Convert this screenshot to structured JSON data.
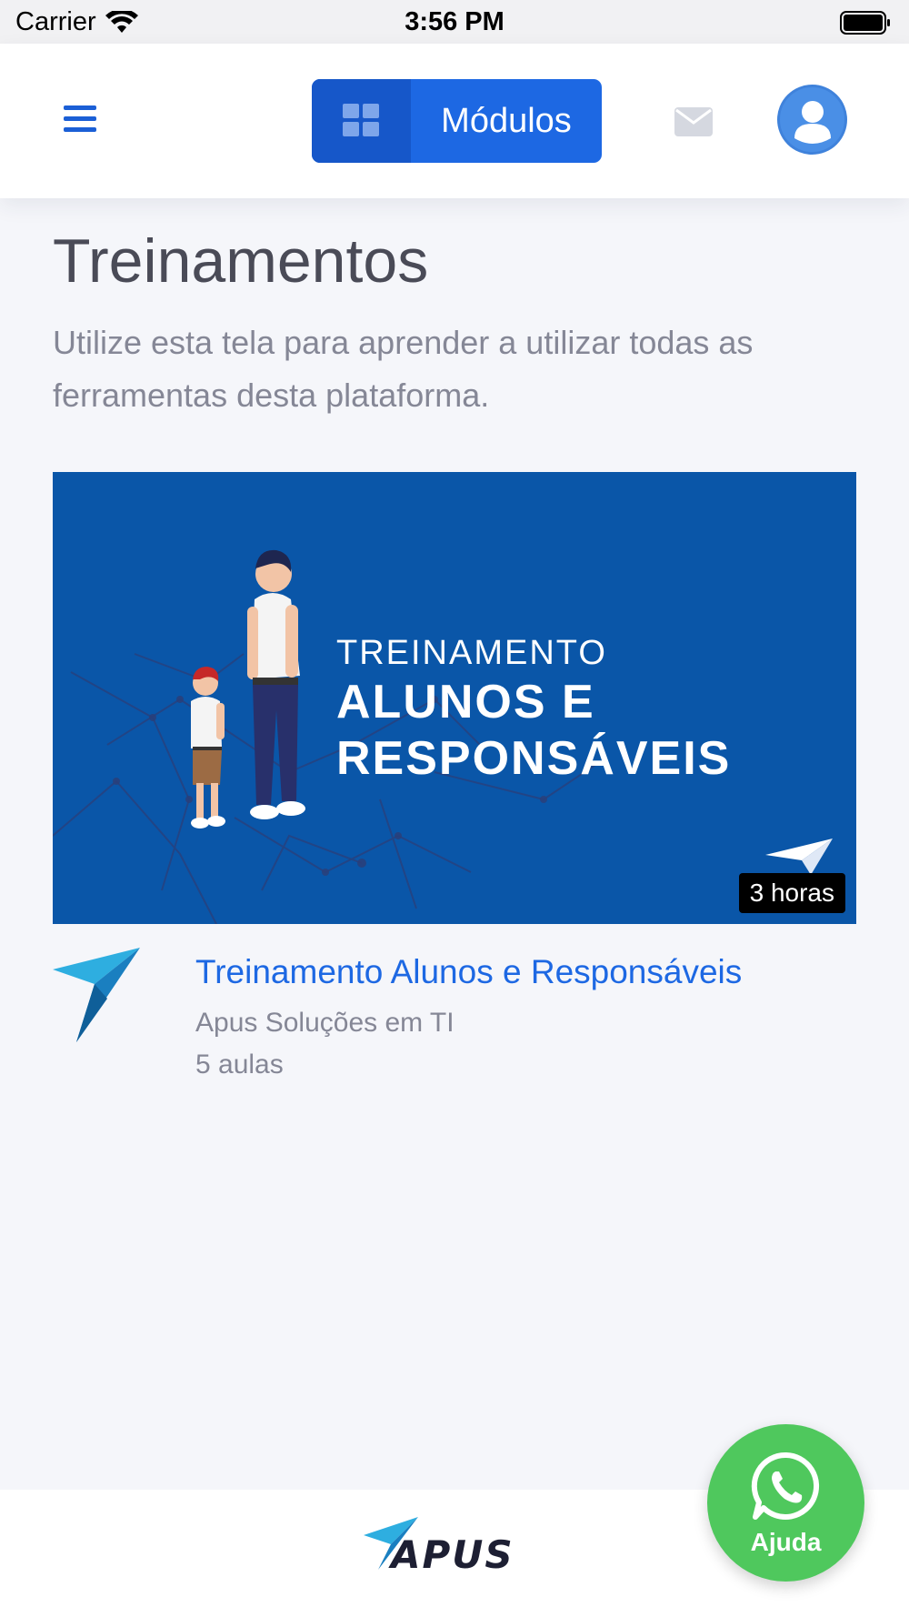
{
  "status_bar": {
    "carrier": "Carrier",
    "time": "3:56 PM"
  },
  "nav": {
    "menu_icon": "hamburger-icon",
    "modules_label": "Módulos",
    "modules_icon": "grid-icon",
    "mail_icon": "mail-icon",
    "avatar_icon": "user-avatar-icon",
    "accent_color": "#1d68e3"
  },
  "page": {
    "title": "Treinamentos",
    "subtitle": "Utilize esta tela para aprender a utilizar todas as ferramentas desta plataforma."
  },
  "courses": [
    {
      "banner_line1": "TREINAMENTO",
      "banner_line2": "ALUNOS E RESPONSÁVEIS",
      "duration": "3 horas",
      "title": "Treinamento Alunos e Responsáveis",
      "author": "Apus Soluções em TI",
      "lessons": "5 aulas",
      "banner_color": "#0a56a8"
    }
  ],
  "footer": {
    "logo_text": "APUS"
  },
  "help": {
    "label": "Ajuda",
    "icon": "whatsapp-icon",
    "color": "#4fc85d"
  }
}
